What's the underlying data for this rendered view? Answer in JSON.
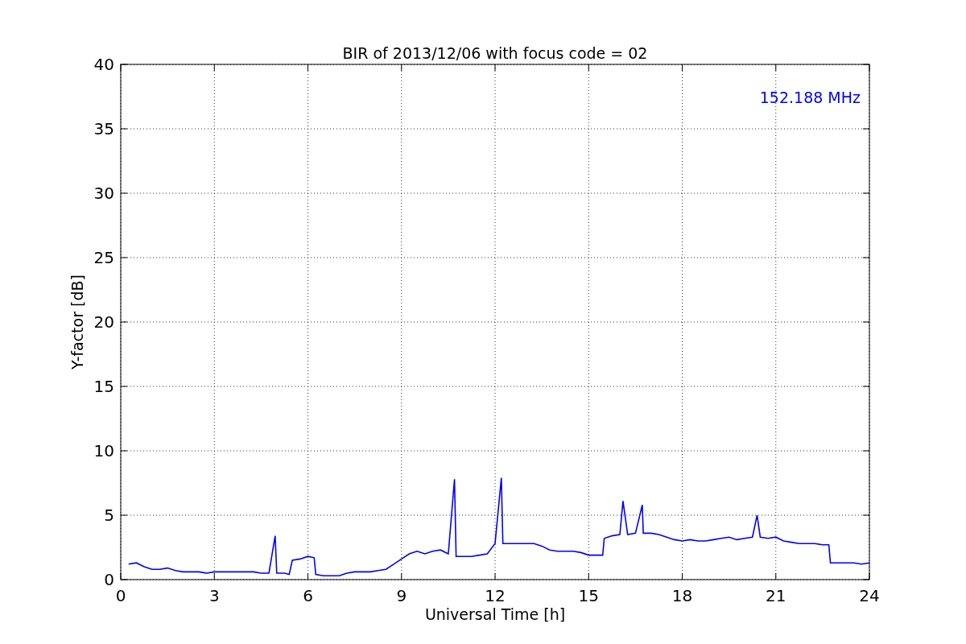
{
  "chart_data": {
    "type": "line",
    "title": "BIR of 2013/12/06 with focus code = 02",
    "xlabel": "Universal Time [h]",
    "ylabel": "Y-factor [dB]",
    "grid": true,
    "xlim": [
      0,
      24
    ],
    "ylim": [
      0,
      40
    ],
    "xticks": [
      0,
      3,
      6,
      9,
      12,
      15,
      18,
      21,
      24
    ],
    "yticks": [
      0,
      5,
      10,
      15,
      20,
      25,
      30,
      35,
      40
    ],
    "x": [
      0.25,
      0.5,
      0.75,
      1.0,
      1.25,
      1.5,
      1.75,
      2.0,
      2.25,
      2.5,
      2.75,
      3.0,
      3.25,
      3.5,
      3.75,
      4.0,
      4.25,
      4.5,
      4.75,
      4.95,
      5.0,
      5.25,
      5.4,
      5.5,
      5.75,
      6.0,
      6.2,
      6.25,
      6.5,
      6.75,
      7.0,
      7.25,
      7.5,
      7.75,
      8.0,
      8.25,
      8.5,
      8.75,
      9.0,
      9.25,
      9.5,
      9.75,
      10.0,
      10.25,
      10.5,
      10.7,
      10.75,
      11.0,
      11.25,
      11.5,
      11.75,
      12.0,
      12.2,
      12.25,
      12.5,
      12.75,
      13.0,
      13.25,
      13.5,
      13.75,
      14.0,
      14.25,
      14.5,
      14.75,
      15.0,
      15.25,
      15.45,
      15.5,
      15.75,
      16.0,
      16.1,
      16.25,
      16.5,
      16.72,
      16.75,
      17.0,
      17.25,
      17.5,
      17.75,
      18.0,
      18.25,
      18.5,
      18.75,
      19.0,
      19.25,
      19.5,
      19.75,
      20.0,
      20.25,
      20.4,
      20.5,
      20.75,
      21.0,
      21.25,
      21.5,
      21.75,
      22.0,
      22.25,
      22.5,
      22.7,
      22.75,
      23.0,
      23.25,
      23.5,
      23.75,
      24.0
    ],
    "series": [
      {
        "name": "152.188 MHz",
        "color": "#0000ff",
        "values": [
          1.2,
          1.3,
          1.0,
          0.8,
          0.8,
          0.9,
          0.7,
          0.6,
          0.6,
          0.6,
          0.5,
          0.6,
          0.6,
          0.6,
          0.6,
          0.6,
          0.6,
          0.5,
          0.5,
          3.4,
          0.5,
          0.5,
          0.4,
          1.5,
          1.6,
          1.8,
          1.7,
          0.4,
          0.3,
          0.3,
          0.3,
          0.5,
          0.6,
          0.6,
          0.6,
          0.7,
          0.8,
          1.2,
          1.6,
          2.0,
          2.2,
          2.0,
          2.2,
          2.3,
          2.0,
          7.8,
          1.8,
          1.8,
          1.8,
          1.9,
          2.0,
          2.8,
          7.9,
          2.8,
          2.8,
          2.8,
          2.8,
          2.8,
          2.6,
          2.3,
          2.2,
          2.2,
          2.2,
          2.1,
          1.9,
          1.9,
          1.9,
          3.2,
          3.4,
          3.5,
          6.1,
          3.5,
          3.6,
          5.8,
          3.6,
          3.6,
          3.5,
          3.3,
          3.1,
          3.0,
          3.1,
          3.0,
          3.0,
          3.1,
          3.2,
          3.3,
          3.1,
          3.2,
          3.3,
          5.0,
          3.3,
          3.2,
          3.3,
          3.0,
          2.9,
          2.8,
          2.8,
          2.8,
          2.7,
          2.7,
          1.3,
          1.3,
          1.3,
          1.3,
          1.2,
          1.3
        ]
      }
    ]
  }
}
